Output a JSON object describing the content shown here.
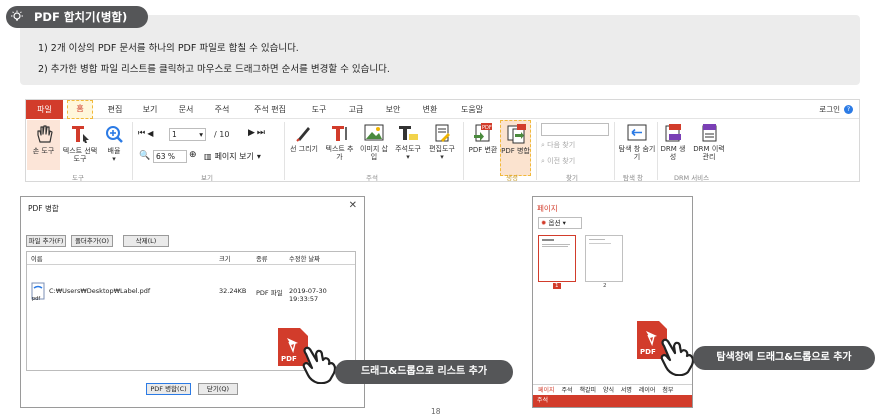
{
  "header": {
    "title": "PDF 합치기(병합)",
    "lines": [
      "1)  2개 이상의 PDF 문서를 하나의 PDF 파일로 합칠 수 있습니다.",
      "2)  추가한 병합 파일 리스트를 클릭하고 마우스로 드래그하면 순서를 변경할 수 있습니다."
    ]
  },
  "ribbon": {
    "menu": [
      "파일",
      "홈",
      "편집",
      "보기",
      "문서",
      "주석",
      "주석 편집",
      "도구",
      "고급",
      "보안",
      "변환",
      "도움말"
    ],
    "login": "로그인",
    "help": "?",
    "tools": {
      "hand": "손 도구",
      "text_select": "텍스트 선택 도구",
      "zoom_mag": "배율",
      "page_input": "1",
      "page_total": "/ 10",
      "zoom_input": "63 %",
      "page_view": "페이지 보기",
      "draw_line": "선 그리기",
      "add_text": "텍스트 추가",
      "insert_image": "이미지 삽입",
      "annot_tool": "주석도구",
      "edit_tool": "편집도구",
      "pdf_convert": "PDF 변환",
      "pdf_merge": "PDF 병합",
      "find_next": "다음 찾기",
      "find_prev": "이전 찾기",
      "hide_explorer": "탐색 창 숨기기",
      "drm_create": "DRM 생성",
      "drm_history": "DRM 이력 관리"
    },
    "groups": {
      "tools": "도구",
      "view": "보기",
      "annot": "주석",
      "create": "생성",
      "find": "찾기",
      "explorer": "탐색 창",
      "drm": "DRM 서비스"
    }
  },
  "dialog": {
    "title": "PDF 병합",
    "close": "✕",
    "buttons": [
      "파일 추가(F)",
      "폴더추가(O)",
      "삭제(L)"
    ],
    "columns": [
      "이름",
      "크기",
      "종류",
      "수정한 날짜"
    ],
    "rows": [
      {
        "name": "C:₩Users₩Desktop₩Label.pdf",
        "size": "32.24KB",
        "type": "PDF 파일",
        "date": "2019-07-30 19:33:57"
      }
    ],
    "file_icon_text": "pdf",
    "merge_btn": "PDF 병합(C)",
    "close_btn": "닫기(Q)"
  },
  "explorer": {
    "title": "페이지",
    "option": "옵션",
    "pages": [
      "1",
      "2"
    ],
    "tabs": [
      "페이지",
      "주석",
      "책갈피",
      "양식",
      "서명",
      "레이어",
      "첨부"
    ],
    "footer": "주석"
  },
  "callouts": {
    "left": "드래그&드롭으로 리스트 추가",
    "right": "탐색창에 드래그&드롭으로 추가"
  },
  "page_number": "18",
  "colors": {
    "accent": "#d23c2b",
    "badge": "#555658",
    "info_bg": "#ececec",
    "highlight_dash": "#f1b93a"
  }
}
